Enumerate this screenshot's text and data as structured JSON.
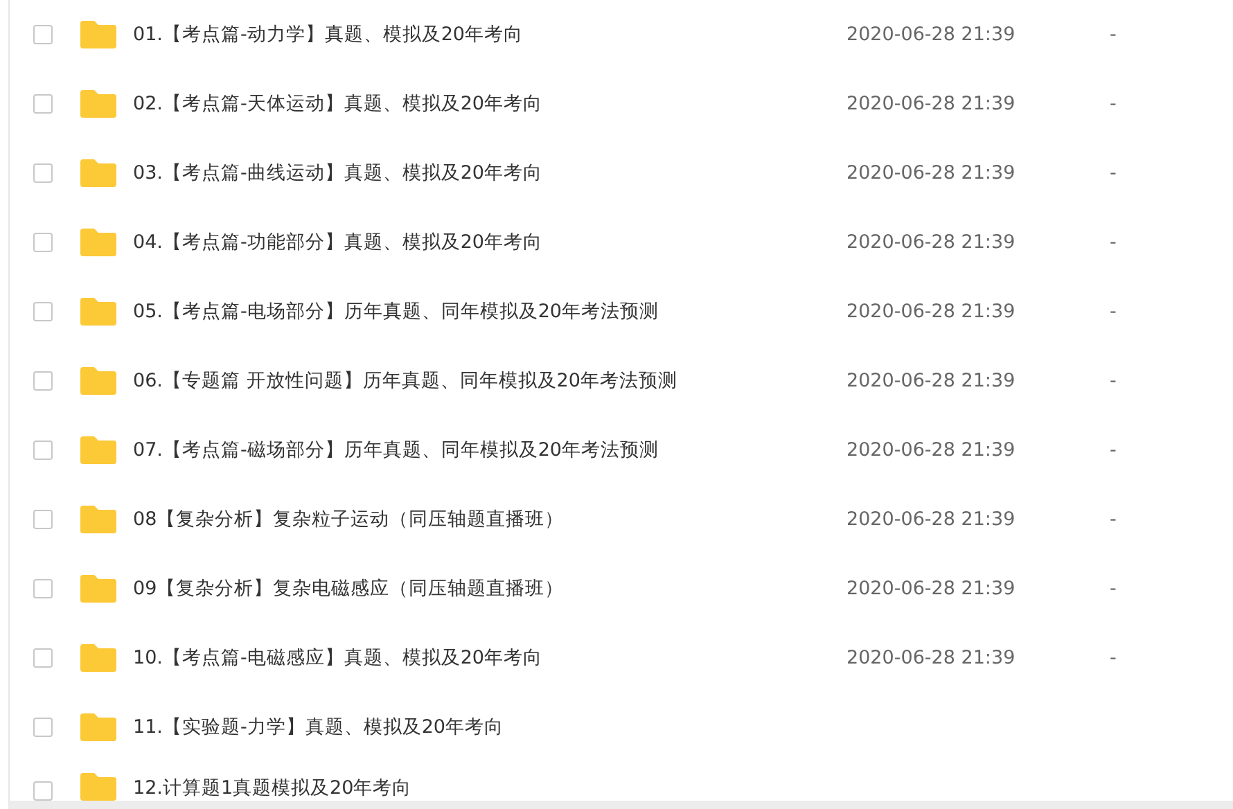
{
  "files": [
    {
      "name": "01.【考点篇-动力学】真题、模拟及20年考向",
      "checked": false,
      "modified": "2020-06-28 21:39",
      "size": "-"
    },
    {
      "name": "02.【考点篇-天体运动】真题、模拟及20年考向",
      "checked": false,
      "modified": "2020-06-28 21:39",
      "size": "-"
    },
    {
      "name": "03.【考点篇-曲线运动】真题、模拟及20年考向",
      "checked": false,
      "modified": "2020-06-28 21:39",
      "size": "-"
    },
    {
      "name": "04.【考点篇-功能部分】真题、模拟及20年考向",
      "checked": false,
      "modified": "2020-06-28 21:39",
      "size": "-"
    },
    {
      "name": "05.【考点篇-电场部分】历年真题、同年模拟及20年考法预测",
      "checked": false,
      "modified": "2020-06-28 21:39",
      "size": "-"
    },
    {
      "name": "06.【专题篇 开放性问题】历年真题、同年模拟及20年考法预测",
      "checked": false,
      "modified": "2020-06-28 21:39",
      "size": "-"
    },
    {
      "name": "07.【考点篇-磁场部分】历年真题、同年模拟及20年考法预测",
      "checked": false,
      "modified": "2020-06-28 21:39",
      "size": "-"
    },
    {
      "name": "08【复杂分析】复杂粒子运动（同压轴题直播班）",
      "checked": false,
      "modified": "2020-06-28 21:39",
      "size": "-"
    },
    {
      "name": "09【复杂分析】复杂电磁感应（同压轴题直播班）",
      "checked": false,
      "modified": "2020-06-28 21:39",
      "size": "-"
    },
    {
      "name": "10.【考点篇-电磁感应】真题、模拟及20年考向",
      "checked": false,
      "modified": "2020-06-28 21:39",
      "size": "-"
    },
    {
      "name": "11.【实验题-力学】真题、模拟及20年考向",
      "checked": false
    },
    {
      "name": "12.计算题1真题模拟及20年考向",
      "checked": false
    }
  ]
}
